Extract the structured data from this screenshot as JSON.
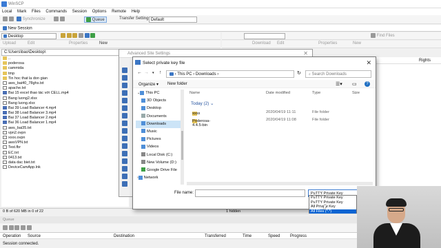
{
  "window": {
    "title": "WinSCP"
  },
  "menu": [
    "Local",
    "Mark",
    "Files",
    "Commands",
    "Session",
    "Options",
    "Remote",
    "Help"
  ],
  "toolbar": {
    "synchronize": "Synchronize",
    "queue": "Queue",
    "transfer_settings_label": "Transfer Settings",
    "transfer_settings_value": "Default"
  },
  "tabs": {
    "new_session": "New Session"
  },
  "local_panel": {
    "drive": "Desktop",
    "upload": "Upload",
    "edit": "Edit",
    "properties": "Properties",
    "new": "New",
    "path": "C:\\Users\\bao\\Desktop\\",
    "files": [
      "..",
      "poderosa",
      "cammida",
      "tmp",
      "Tin hoc that la don gian",
      "aws_bai40_78ghs.txt",
      "apache.txt",
      "Bai 15 excel thao tác với CELL.mp4",
      "Bang luong2.xlsx",
      "Bang luong.xlsx",
      "Bai 39 Load Balancer 4.mp4",
      "Bai 38 Load Balancer 3.mp4",
      "Bai 37 Load Balancer 2.mp4",
      "Bai 36 Load Balancer 1.mp4",
      "aws_bai35.txt",
      "vpn2.ovpn",
      "xxxx.ovpn",
      "awsVPN.txt",
      "Test.fbr",
      "EC.txt",
      "0413.txt",
      "data dac biet.txt",
      "DeviceCamApp.lnk"
    ],
    "status": "0 B of 620 MB in 0 of 22"
  },
  "remote_panel": {
    "download": "Download",
    "edit": "Edit",
    "properties": "Properties",
    "new": "New",
    "find_files": "Find Files",
    "col_rights": "Rights",
    "status": "1 hidden"
  },
  "queue": {
    "title": "Queue",
    "columns": [
      "Operation",
      "Source",
      "Destination",
      "Transferred",
      "Time",
      "Speed",
      "Progress"
    ]
  },
  "connection_status": "Session connected.",
  "advanced_dialog": {
    "title": "Advanced Site Settings"
  },
  "file_dialog": {
    "title": "Select private key file",
    "breadcrumb": [
      "This PC",
      "Downloads"
    ],
    "search_placeholder": "Search Downloads",
    "organize": "Organize",
    "new_folder": "New folder",
    "tree": [
      "This PC",
      "3D Objects",
      "Desktop",
      "Documents",
      "Downloads",
      "Music",
      "Pictures",
      "Videos",
      "Local Disk (C:)",
      "New Volume (D:)",
      "Google Drive File",
      "Network"
    ],
    "columns": {
      "name": "Name",
      "date": "Date modified",
      "type": "Type",
      "size": "Size"
    },
    "group": "Today (2)",
    "items": [
      {
        "name": "xxxx",
        "date": "2020/04/19 11:11",
        "type": "File folder"
      },
      {
        "name": "Poderosa-4.4.5-bin",
        "date": "2020/04/19 11:08",
        "type": "File folder"
      }
    ],
    "filename_label": "File name:",
    "filetype_value": "PuTTY Private Key",
    "filetype_options": [
      "PuTTY Private Key",
      "PuTTY Private Key",
      "All Private Key",
      "All Files (*.*)"
    ]
  }
}
